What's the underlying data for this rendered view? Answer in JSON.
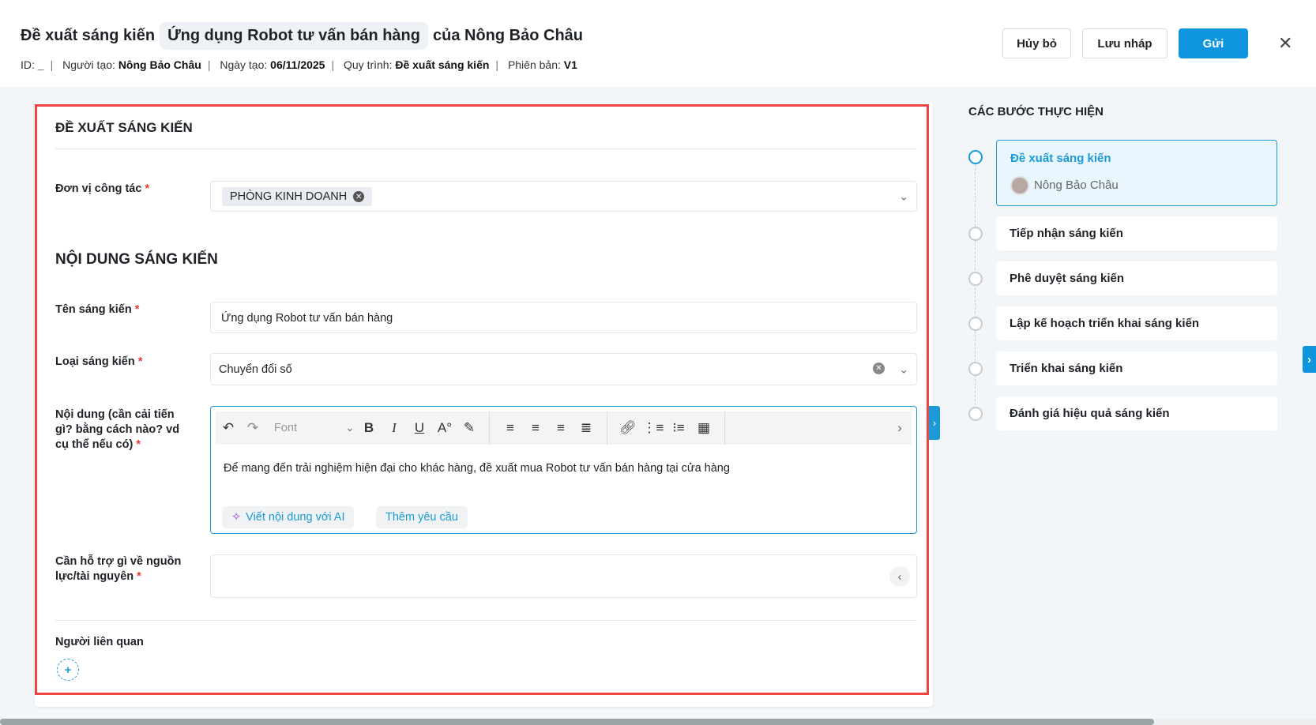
{
  "header": {
    "title_prefix": "Đề xuất sáng kiến",
    "title_name": "Ứng dụng Robot tư vấn bán hàng",
    "title_suffix": "của Nông Bảo Châu",
    "meta": {
      "id_label": "ID:",
      "id_value": "_",
      "creator_label": "Người tạo:",
      "creator": "Nông Bảo Châu",
      "date_label": "Ngày tạo:",
      "date": "06/11/2025",
      "process_label": "Quy trình:",
      "process": "Đề xuất sáng kiến",
      "version_label": "Phiên bản:",
      "version": "V1"
    },
    "buttons": {
      "cancel": "Hủy bỏ",
      "draft": "Lưu nháp",
      "send": "Gửi"
    }
  },
  "form": {
    "section1": "ĐỀ XUẤT SÁNG KIẾN",
    "unit_label": "Đơn vị công tác",
    "unit_tag": "PHÒNG KINH DOANH",
    "section2": "NỘI DUNG SÁNG KIẾN",
    "name_label": "Tên sáng kiến",
    "name_value": "Ứng dụng Robot tư vấn bán hàng",
    "type_label": "Loại sáng kiến",
    "type_value": "Chuyển đổi số",
    "content_label": "Nội dung (cần cải tiến gì? bằng cách nào? vd cụ thể nếu có)",
    "editor": {
      "font": "Font",
      "text": "Để mang đến trải nghiệm hiện đại cho khác hàng, đề xuất mua Robot tư vấn bán hàng tại cửa hàng",
      "ai_button": "Viết nội dung với AI",
      "add_request": "Thêm yêu cầu"
    },
    "resource_label": "Cần hỗ trợ gì về nguồn lực/tài nguyên",
    "related_label": "Người liên quan",
    "required_mark": "*"
  },
  "steps": {
    "title": "CÁC BƯỚC THỰC HIỆN",
    "items": [
      {
        "label": "Đề xuất sáng kiến",
        "assignee": "Nông Bảo Châu",
        "active": true
      },
      {
        "label": "Tiếp nhận sáng kiến"
      },
      {
        "label": "Phê duyệt sáng kiến"
      },
      {
        "label": "Lập kế hoạch triển khai sáng kiến"
      },
      {
        "label": "Triển khai sáng kiến"
      },
      {
        "label": "Đánh giá hiệu quả sáng kiến"
      }
    ]
  },
  "colors": {
    "accent": "#0e95de",
    "highlight_border": "#f04444"
  }
}
